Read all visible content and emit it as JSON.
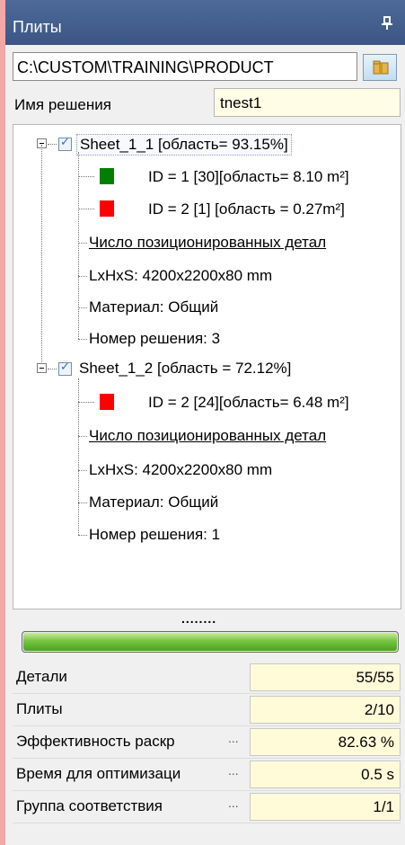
{
  "panel": {
    "title": "Плиты",
    "pin_glyph": "ᵖ"
  },
  "path": {
    "value": "C:\\CUSTOM\\TRAINING\\PRODUCT"
  },
  "solution": {
    "label": "Имя решения",
    "value": "tnest1"
  },
  "tree": {
    "sheets": [
      {
        "label": "Sheet_1_1 [область= 93.15%]",
        "items": [
          {
            "label": "ID = 1 [30][область= 8.10 m²]",
            "color": "#008000"
          },
          {
            "label": "ID = 2 [1] [область = 0.27m²]",
            "color": "#ff0000"
          }
        ],
        "count_label": "Число позиционированных детал",
        "size": "LxHxS: 4200x2200x80  mm",
        "material": "Материал: Общий",
        "solution_no": "Номер решения: 3"
      },
      {
        "label": "Sheet_1_2 [область = 72.12%]",
        "items": [
          {
            "label": "ID = 2 [24][область= 6.48 m²]",
            "color": "#ff0000"
          }
        ],
        "count_label": "Число позиционированных детал",
        "size": "LxHxS: 4200x2200x80  mm",
        "material": "Материал: Общий",
        "solution_no": "Номер решения: 1"
      }
    ]
  },
  "splitter": {
    "dots": "........"
  },
  "progress": {
    "fraction": 1.0,
    "color": "#49a420"
  },
  "stats": [
    {
      "label": "Детали",
      "value": "55/55",
      "ellipsis": ""
    },
    {
      "label": "Плиты",
      "value": "2/10",
      "ellipsis": ""
    },
    {
      "label": "Эффективность раскр",
      "value": "82.63 %",
      "ellipsis": "..."
    },
    {
      "label": "Время для оптимизаци",
      "value": "0.5 s",
      "ellipsis": "..."
    },
    {
      "label": "Группа соответствия",
      "value": "1/1",
      "ellipsis": "..."
    }
  ]
}
